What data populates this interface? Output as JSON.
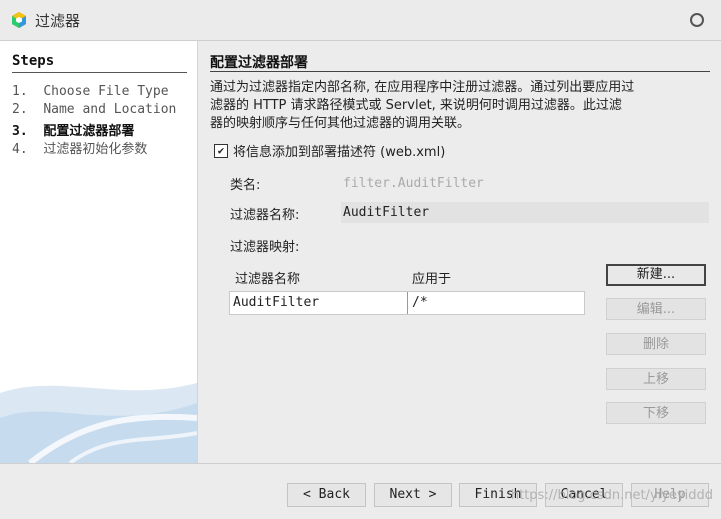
{
  "window": {
    "title": "过滤器",
    "icon": "netbeans-cube-icon",
    "control_icon": "circle-icon"
  },
  "steps": {
    "title": "Steps",
    "items": [
      {
        "num": "1.",
        "label": "Choose File Type"
      },
      {
        "num": "2.",
        "label": "Name and Location"
      },
      {
        "num": "3.",
        "label": "配置过滤器部署"
      },
      {
        "num": "4.",
        "label": "过滤器初始化参数"
      }
    ],
    "active_index": 2
  },
  "main": {
    "section_title": "配置过滤器部署",
    "description_lines": [
      "通过为过滤器指定内部名称, 在应用程序中注册过滤器。通过列出要应用过",
      "滤器的 HTTP 请求路径模式或 Servlet, 来说明何时调用过滤器。此过滤",
      "器的映射顺序与任何其他过滤器的调用关联。"
    ],
    "checkbox": {
      "checked": true,
      "label": "将信息添加到部署描述符 (web.xml)"
    },
    "class_name_label": "类名:",
    "class_name_value": "filter.AuditFilter",
    "filter_name_label": "过滤器名称:",
    "filter_name_value": "AuditFilter",
    "mapping_label": "过滤器映射:",
    "table": {
      "columns": [
        "过滤器名称",
        "应用于"
      ],
      "rows": [
        {
          "name": "AuditFilter",
          "applies_to": "/*"
        }
      ]
    },
    "buttons": {
      "new": "新建...",
      "edit": "编辑...",
      "delete": "删除",
      "move_up": "上移",
      "move_down": "下移"
    }
  },
  "footer": {
    "back": "< Back",
    "next": "Next >",
    "finish": "Finish",
    "cancel": "Cancel",
    "help": "Help",
    "watermark": "https://blog.csdn.net/yiyeyiddd"
  }
}
